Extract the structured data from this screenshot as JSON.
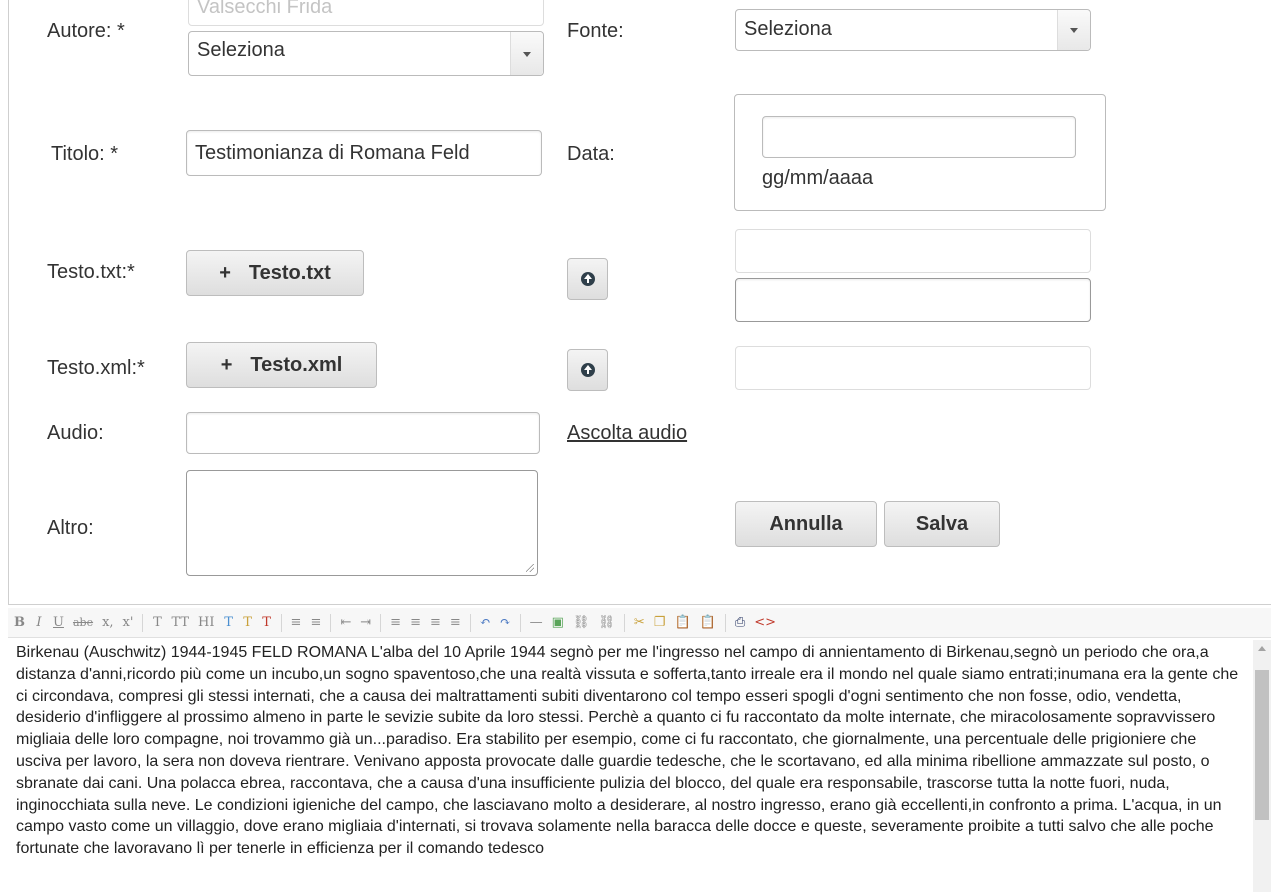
{
  "form": {
    "autore": {
      "label": "Autore: *",
      "partial_value": "Valsecchi Frida",
      "select_value": "Seleziona"
    },
    "fonte": {
      "label": "Fonte:",
      "select_value": "Seleziona"
    },
    "titolo": {
      "label": "Titolo: *",
      "value": "Testimonianza di Romana Feld"
    },
    "data": {
      "label": "Data:",
      "value": "",
      "format_hint": "gg/mm/aaaa"
    },
    "testo_txt": {
      "label": "Testo.txt:*",
      "button_label": "Testo.txt"
    },
    "testo_xml": {
      "label": "Testo.xml:*",
      "button_label": "Testo.xml"
    },
    "audio": {
      "label": "Audio:",
      "value": "",
      "link_text": "Ascolta audio"
    },
    "altro": {
      "label": "Altro:",
      "value": ""
    },
    "buttons": {
      "cancel": "Annulla",
      "save": "Salva"
    }
  },
  "toolbar_icons": [
    "bold-icon",
    "italic-icon",
    "underline-icon",
    "strikethrough-icon",
    "subscript-icon",
    "superscript-icon",
    "font-size-icon",
    "font-family-icon",
    "heading-icon",
    "text-color-icon",
    "paste-format-icon",
    "remove-format-icon",
    "bullet-list-icon",
    "numbered-list-icon",
    "outdent-icon",
    "indent-icon",
    "align-left-icon",
    "align-center-icon",
    "align-right-icon",
    "justify-icon",
    "undo-icon",
    "redo-icon",
    "horizontal-rule-icon",
    "image-icon",
    "link-icon",
    "unlink-icon",
    "cut-icon",
    "copy-icon",
    "paste-icon",
    "paste-word-icon",
    "print-icon",
    "source-icon"
  ],
  "toolbar_glyphs": [
    "B",
    "I",
    "U",
    "abe",
    "x,",
    "x'",
    "T",
    "TT",
    "HI",
    "T",
    "T",
    "T",
    "≡",
    "≡",
    "⇤",
    "⇥",
    "≡",
    "≡",
    "≡",
    "≡",
    "↶",
    "↷",
    "—",
    "▣",
    "⛓",
    "⛓",
    "✂",
    "❐",
    "📋",
    "📋",
    "⎙",
    "<>"
  ],
  "editor": {
    "text": "Birkenau (Auschwitz) 1944-1945 FELD ROMANA L'alba del 10 Aprile 1944 segnò per me l'ingresso nel campo di annientamento di Birkenau,segnò un periodo che ora,a distanza d'anni,ricordo più come un incubo,un sogno spaventoso,che una realtà vissuta e sofferta,tanto irreale era il mondo nel quale siamo entrati;inumana era la gente che ci circondava, compresi gli stessi internati, che a causa dei maltrattamenti subiti diventarono col tempo esseri spogli d'ogni sentimento che non fosse, odio, vendetta, desiderio d'infliggere al prossimo almeno in parte le sevizie subite da loro stessi. Perchè a quanto ci fu raccontato da molte internate, che miracolosamente sopravvissero migliaia delle loro compagne, noi trovammo già un...paradiso. Era stabilito per esempio, come ci fu raccontato, che giornalmente, una percentuale delle prigioniere che usciva per lavoro, la sera non doveva rientrare. Venivano apposta provocate dalle guardie tedesche, che le scortavano, ed alla minima ribellione ammazzate sul posto, o sbranate dai cani. Una polacca ebrea, raccontava, che a causa d'una insufficiente pulizia del blocco, del quale era responsabile, trascorse tutta la notte fuori, nuda, inginocchiata sulla neve. Le condizioni igieniche del campo, che lasciavano molto a desiderare, al nostro ingresso, erano già eccellenti,in confronto a prima. L'acqua, in un campo vasto come un villaggio, dove erano migliaia d'internati, si trovava solamente nella baracca delle docce e queste, severamente proibite a tutti salvo che alle poche fortunate che lavoravano lì per tenerle in efficienza per il comando tedesco"
  }
}
